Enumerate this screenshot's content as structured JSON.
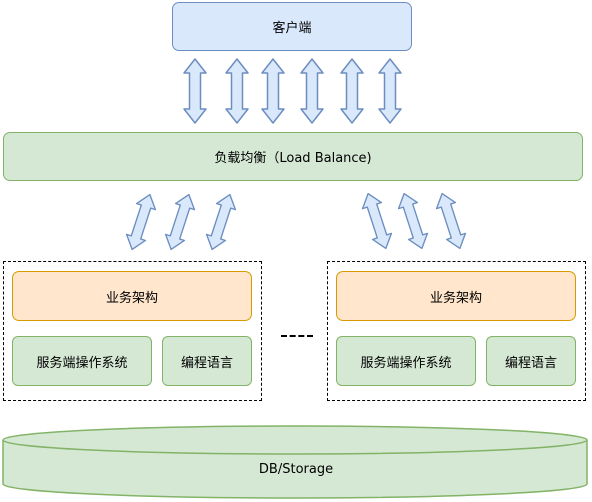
{
  "client": {
    "label": "客户端"
  },
  "load_balancer": {
    "label": "负载均衡（Load Balance)"
  },
  "servers": [
    {
      "business": "业务架构",
      "os": "服务端操作系统",
      "lang": "编程语言"
    },
    {
      "business": "业务架构",
      "os": "服务端操作系统",
      "lang": "编程语言"
    }
  ],
  "storage": {
    "label": "DB/Storage"
  },
  "colors": {
    "blue_fill": "#dae8fc",
    "blue_stroke": "#6c8ebf",
    "green_fill": "#d5e8d4",
    "green_stroke": "#82b366",
    "orange_fill": "#ffe6cc",
    "orange_stroke": "#d79b00"
  }
}
